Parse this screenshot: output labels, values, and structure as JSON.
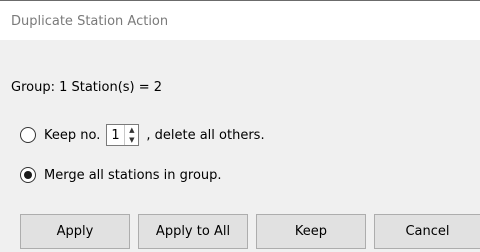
{
  "window": {
    "title": "Duplicate Station Action"
  },
  "info": {
    "group_label": "Group: 1  Station(s) = 2"
  },
  "options": {
    "keep_prefix": "Keep no.",
    "keep_value": "1",
    "keep_suffix": ", delete all others.",
    "keep_selected": false,
    "merge_label": "Merge all stations in group.",
    "merge_selected": true
  },
  "buttons": {
    "apply": "Apply",
    "apply_all": "Apply to All",
    "keep": "Keep",
    "cancel": "Cancel"
  },
  "icons": {
    "spin_up": "chevron-up-icon",
    "spin_down": "chevron-down-icon"
  }
}
